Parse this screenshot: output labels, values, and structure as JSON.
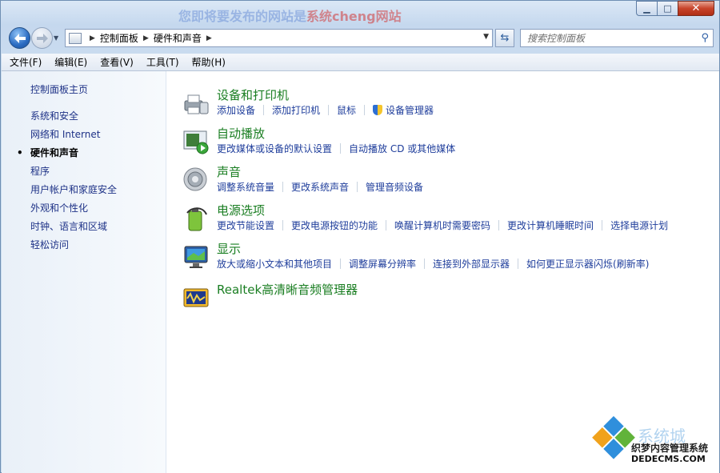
{
  "titlebar": {
    "watermark_main": "您即将要发布的网站是",
    "watermark_red": "系统cheng网站",
    "min_label": "▁",
    "max_label": "□",
    "close_label": "✕"
  },
  "nav": {
    "breadcrumb": [
      "控制面板",
      "硬件和声音"
    ],
    "search_placeholder": "搜索控制面板"
  },
  "menu": [
    "文件(F)",
    "编辑(E)",
    "查看(V)",
    "工具(T)",
    "帮助(H)"
  ],
  "sidebar": {
    "home": "控制面板主页",
    "items": [
      {
        "label": "系统和安全"
      },
      {
        "label": "网络和 Internet"
      },
      {
        "label": "硬件和声音",
        "active": true
      },
      {
        "label": "程序"
      },
      {
        "label": "用户帐户和家庭安全"
      },
      {
        "label": "外观和个性化"
      },
      {
        "label": "时钟、语言和区域"
      },
      {
        "label": "轻松访问"
      }
    ]
  },
  "categories": [
    {
      "title": "设备和打印机",
      "icon": "printer-icon",
      "links": [
        "添加设备",
        "添加打印机",
        "鼠标",
        "设备管理器"
      ]
    },
    {
      "title": "自动播放",
      "icon": "autoplay-icon",
      "links": [
        "更改媒体或设备的默认设置",
        "自动播放 CD 或其他媒体"
      ]
    },
    {
      "title": "声音",
      "icon": "speaker-icon",
      "links": [
        "调整系统音量",
        "更改系统声音",
        "管理音频设备"
      ]
    },
    {
      "title": "电源选项",
      "icon": "battery-icon",
      "links": [
        "更改节能设置",
        "更改电源按钮的功能",
        "唤醒计算机时需要密码",
        "更改计算机睡眠时间",
        "选择电源计划"
      ]
    },
    {
      "title": "显示",
      "icon": "monitor-icon",
      "links": [
        "放大或缩小文本和其他项目",
        "调整屏幕分辨率",
        "连接到外部显示器",
        "如何更正显示器闪烁(刷新率)"
      ]
    },
    {
      "title": "Realtek高清晰音频管理器",
      "icon": "realtek-icon",
      "links": []
    }
  ],
  "watermark": {
    "big": "系统城",
    "line1": "织梦内容管理系统",
    "line2": "DEDECMS.COM"
  }
}
